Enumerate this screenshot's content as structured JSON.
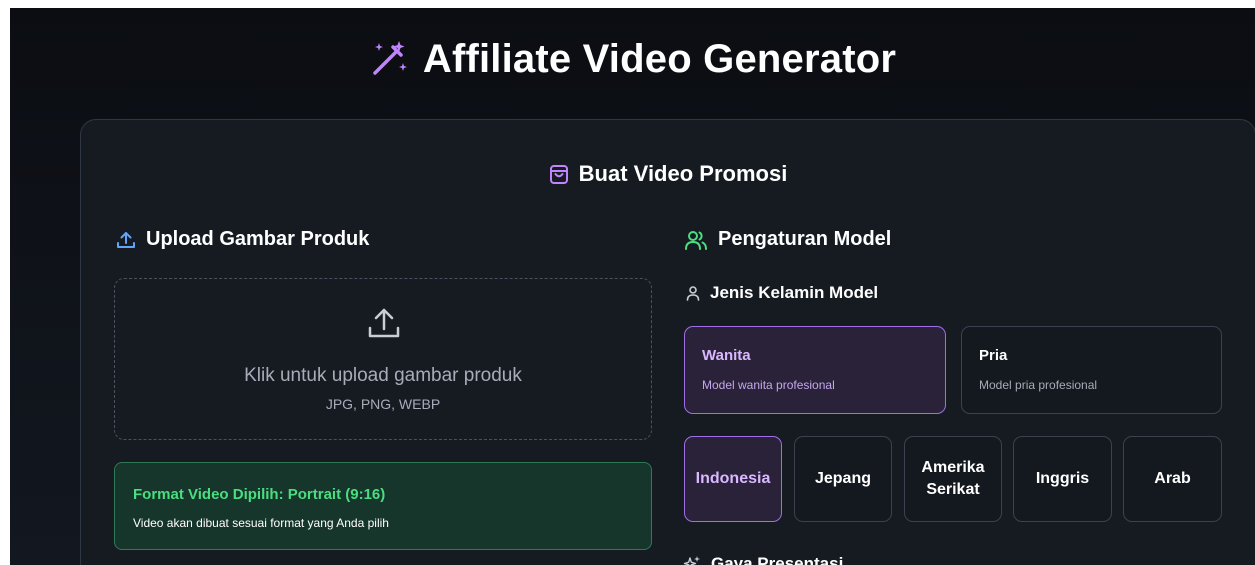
{
  "header": {
    "title": "Affiliate Video Generator",
    "icon": "magic-wand-icon",
    "icon_color": "#c084fc"
  },
  "card": {
    "title": "Buat Video Promosi",
    "icon": "shopping-bag-icon",
    "icon_color": "#c084fc"
  },
  "upload": {
    "section_title": "Upload Gambar Produk",
    "section_icon": "upload-icon",
    "section_icon_color": "#60a5fa",
    "dropzone_text": "Klik untuk upload gambar produk",
    "dropzone_formats": "JPG, PNG, WEBP"
  },
  "format_notice": {
    "title": "Format Video Dipilih: Portrait (9:16)",
    "description": "Video akan dibuat sesuai format yang Anda pilih",
    "accent_color": "#4ade80"
  },
  "model_settings": {
    "section_title": "Pengaturan Model",
    "section_icon": "users-icon",
    "section_icon_color": "#4ade80",
    "gender_label": "Jenis Kelamin Model",
    "gender_icon": "user-icon",
    "gender_options": [
      {
        "title": "Wanita",
        "description": "Model wanita profesional",
        "selected": true
      },
      {
        "title": "Pria",
        "description": "Model pria profesional",
        "selected": false
      }
    ],
    "nationality_options": [
      {
        "label": "Indonesia",
        "selected": true
      },
      {
        "label": "Jepang",
        "selected": false
      },
      {
        "label": "Amerika\nSerikat",
        "selected": false
      },
      {
        "label": "Inggris",
        "selected": false
      },
      {
        "label": "Arab",
        "selected": false
      }
    ],
    "presentation_label": "Gaya Presentasi",
    "presentation_icon": "sparkles-icon"
  },
  "colors": {
    "background": "#0b0d12",
    "card": "#161b22",
    "selected_accent": "#a16ee8"
  }
}
